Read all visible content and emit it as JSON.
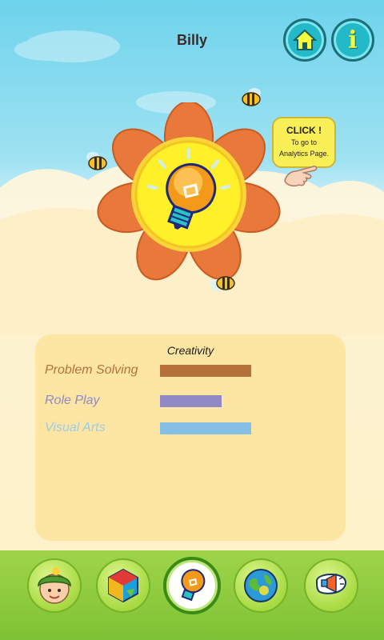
{
  "header": {
    "title": "Billy"
  },
  "buttons": {
    "home": "home-icon",
    "info": "i"
  },
  "tooltip": {
    "headline": "CLICK !",
    "line1": "To go to",
    "line2": "Analytics Page."
  },
  "panel": {
    "title": "Creativity",
    "skills": [
      {
        "label": "Problem Solving",
        "color": "#b5703a",
        "value": 0.52
      },
      {
        "label": "Role Play",
        "color": "#8f89c6",
        "value": 0.35
      },
      {
        "label": "Visual Arts",
        "color": "#86bfe6",
        "value": 0.52
      }
    ]
  },
  "nav": {
    "items": [
      {
        "icon": "child-face-icon",
        "active": false
      },
      {
        "icon": "shapes-cube-icon",
        "active": false
      },
      {
        "icon": "lightbulb-icon",
        "active": true
      },
      {
        "icon": "globe-icon",
        "active": false
      },
      {
        "icon": "megaphone-icon",
        "active": false
      }
    ]
  },
  "colors": {
    "sky": "#6ed3ec",
    "sand": "#fdf1c6",
    "grass": "#8fcb3c",
    "accent": "#23b9c8"
  }
}
